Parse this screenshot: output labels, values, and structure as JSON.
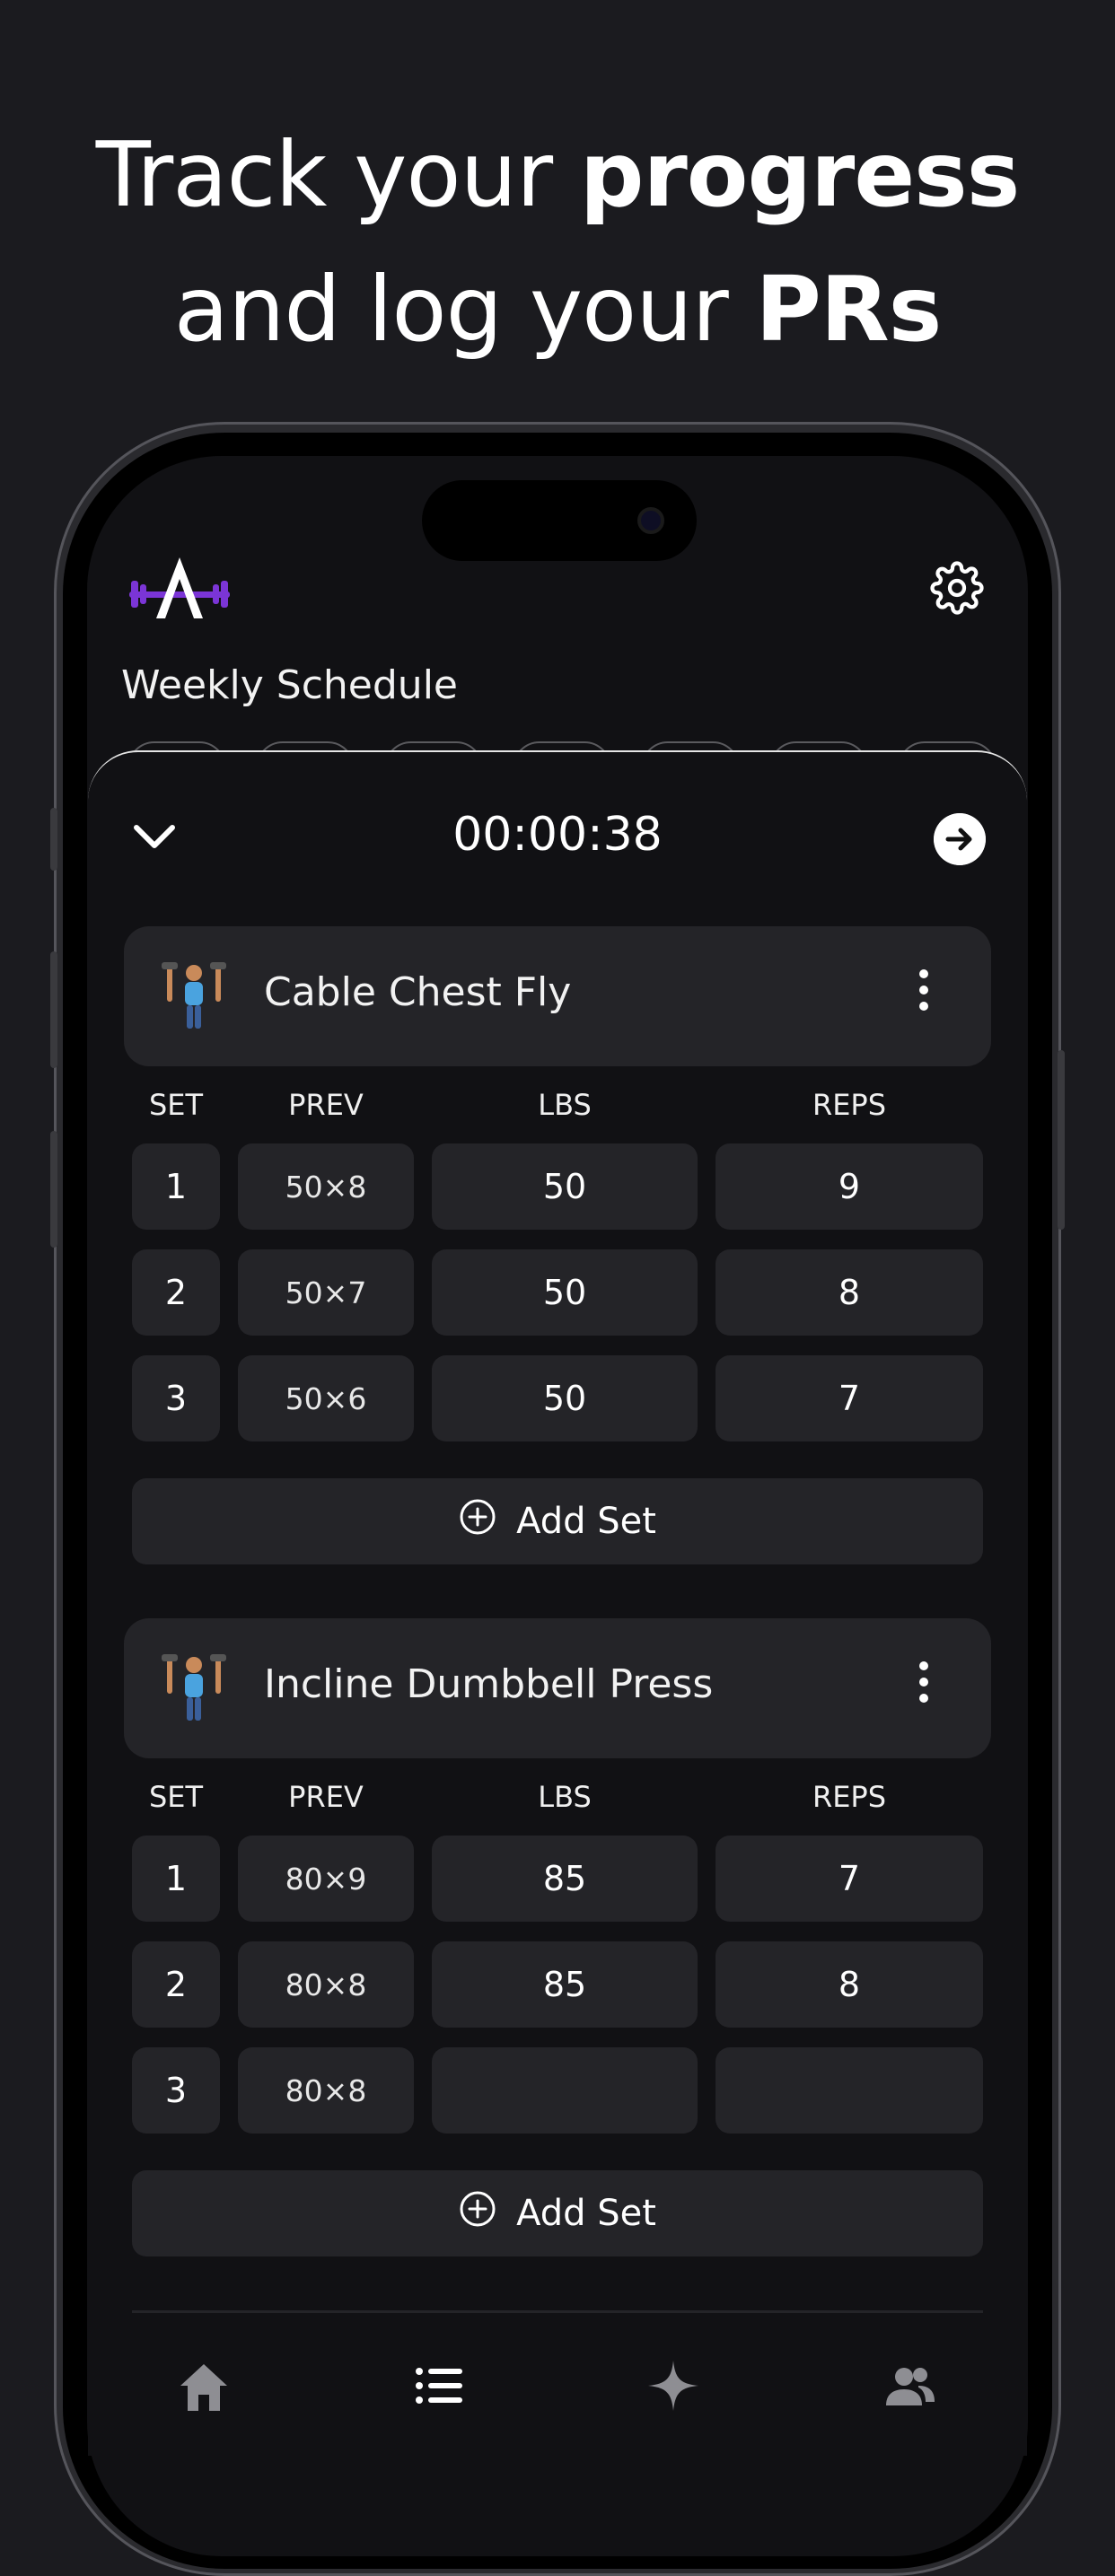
{
  "headline": {
    "part1": "Track your ",
    "bold1": "progress",
    "part2": " and log your ",
    "bold2": "PRs"
  },
  "app": {
    "logo_icon": "barbell-a-logo",
    "settings_icon": "gear-icon",
    "section_title": "Weekly Schedule",
    "accent_color": "#7b35d6"
  },
  "workout": {
    "timer": "00:00:38",
    "collapse_icon": "chevron-down-icon",
    "finish_icon": "arrow-right-circle-icon",
    "columns": {
      "set": "SET",
      "prev": "PREV",
      "lbs": "LBS",
      "reps": "REPS"
    },
    "add_set_label": "Add Set",
    "exercises": [
      {
        "name": "Cable Chest Fly",
        "emoji": "🏋",
        "sets": [
          {
            "set": "1",
            "prev": "50×8",
            "lbs": "50",
            "reps": "9"
          },
          {
            "set": "2",
            "prev": "50×7",
            "lbs": "50",
            "reps": "8"
          },
          {
            "set": "3",
            "prev": "50×6",
            "lbs": "50",
            "reps": "7"
          }
        ]
      },
      {
        "name": "Incline Dumbbell Press",
        "emoji": "🏋",
        "sets": [
          {
            "set": "1",
            "prev": "80×9",
            "lbs": "85",
            "reps": "7"
          },
          {
            "set": "2",
            "prev": "80×8",
            "lbs": "85",
            "reps": "8"
          },
          {
            "set": "3",
            "prev": "80×8",
            "lbs": "",
            "reps": ""
          }
        ]
      }
    ]
  },
  "tabbar": {
    "items": [
      {
        "icon": "home-icon"
      },
      {
        "icon": "list-icon"
      },
      {
        "icon": "sparkle-icon"
      },
      {
        "icon": "people-icon"
      }
    ]
  }
}
